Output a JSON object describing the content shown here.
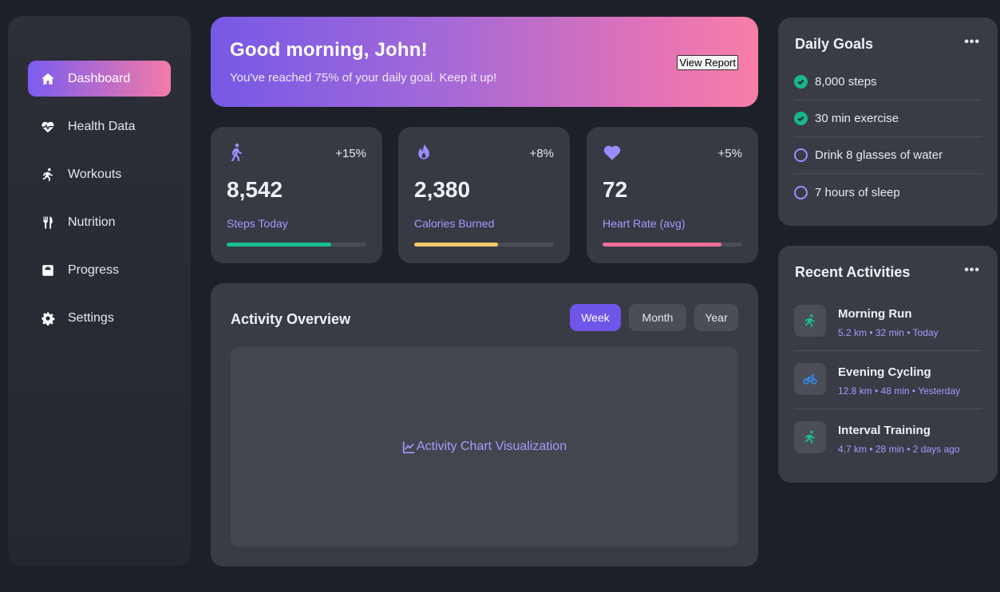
{
  "sidebar": {
    "items": [
      {
        "label": "Dashboard",
        "icon": "home-icon",
        "active": true
      },
      {
        "label": "Health Data",
        "icon": "heart-pulse-icon",
        "active": false
      },
      {
        "label": "Workouts",
        "icon": "running-icon",
        "active": false
      },
      {
        "label": "Nutrition",
        "icon": "utensils-icon",
        "active": false
      },
      {
        "label": "Progress",
        "icon": "weight-scale-icon",
        "active": false
      },
      {
        "label": "Settings",
        "icon": "gear-icon",
        "active": false
      }
    ]
  },
  "hero": {
    "greeting": "Good morning, John!",
    "message": "You've reached 75% of your daily goal. Keep it up!",
    "button_label": "View Report"
  },
  "stats": [
    {
      "icon": "walking-icon",
      "change": "+15%",
      "value": "8,542",
      "label": "Steps Today",
      "progress": 0.75,
      "color": "#19c08f"
    },
    {
      "icon": "fire-icon",
      "change": "+8%",
      "value": "2,380",
      "label": "Calories Burned",
      "progress": 0.6,
      "color": "#fbc96b"
    },
    {
      "icon": "heart-icon",
      "change": "+5%",
      "value": "72",
      "label": "Heart Rate (avg)",
      "progress": 0.85,
      "color": "#f16d9a"
    }
  ],
  "overview": {
    "title": "Activity Overview",
    "ranges": [
      {
        "label": "Week",
        "active": true
      },
      {
        "label": "Month",
        "active": false
      },
      {
        "label": "Year",
        "active": false
      }
    ],
    "chart_placeholder": "Activity Chart Visualization"
  },
  "goals": {
    "title": "Daily Goals",
    "more_label": "•••",
    "items": [
      {
        "label": "8,000 steps",
        "done": true
      },
      {
        "label": "30 min exercise",
        "done": true
      },
      {
        "label": "Drink 8 glasses of water",
        "done": false
      },
      {
        "label": "7 hours of sleep",
        "done": false
      }
    ]
  },
  "activities": {
    "title": "Recent Activities",
    "more_label": "•••",
    "items": [
      {
        "name": "Morning Run",
        "meta": "5.2 km • 32 min • Today",
        "icon": "running-icon",
        "color": "#19c08f"
      },
      {
        "name": "Evening Cycling",
        "meta": "12.8 km • 48 min • Yesterday",
        "icon": "bicycle-icon",
        "color": "#2f8cf0"
      },
      {
        "name": "Interval Training",
        "meta": "4.7 km • 28 min • 2 days ago",
        "icon": "running-icon",
        "color": "#19c08f"
      }
    ]
  },
  "colors": {
    "accent": "#6f55e8",
    "accent_light": "#a898ff",
    "gradient_start": "#7b5cf0",
    "gradient_end": "#f47aa6"
  }
}
